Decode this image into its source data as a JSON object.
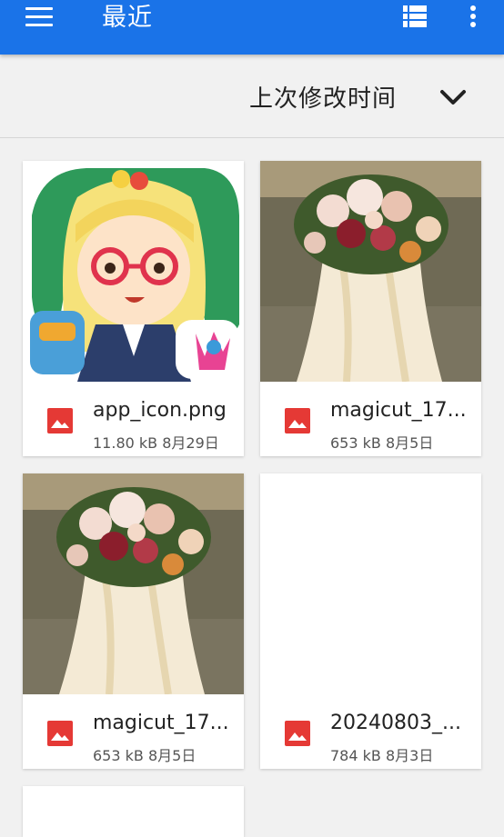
{
  "appbar": {
    "title": "最近",
    "menu_icon": "hamburger-menu-icon",
    "view_icon": "list-view-icon",
    "more_icon": "more-vert-icon",
    "color": "#1a73e8"
  },
  "sort": {
    "label": "上次修改时间",
    "icon": "chevron-down-icon"
  },
  "files": [
    {
      "name": "app_icon.png",
      "size": "11.80 kB",
      "date": "8月29日",
      "icon": "image-file-icon",
      "thumbnail": "cartoon-girl"
    },
    {
      "name": "magicut_17...",
      "size": "653 kB",
      "date": "8月5日",
      "icon": "image-file-icon",
      "thumbnail": "bouquet-photo"
    },
    {
      "name": "magicut_17...",
      "size": "653 kB",
      "date": "8月5日",
      "icon": "image-file-icon",
      "thumbnail": "bouquet-photo"
    },
    {
      "name": "20240803_...",
      "size": "784 kB",
      "date": "8月3日",
      "icon": "image-file-icon",
      "thumbnail": "blank"
    }
  ],
  "colors": {
    "file_icon": "#e53935",
    "background": "#f1f1f1"
  }
}
